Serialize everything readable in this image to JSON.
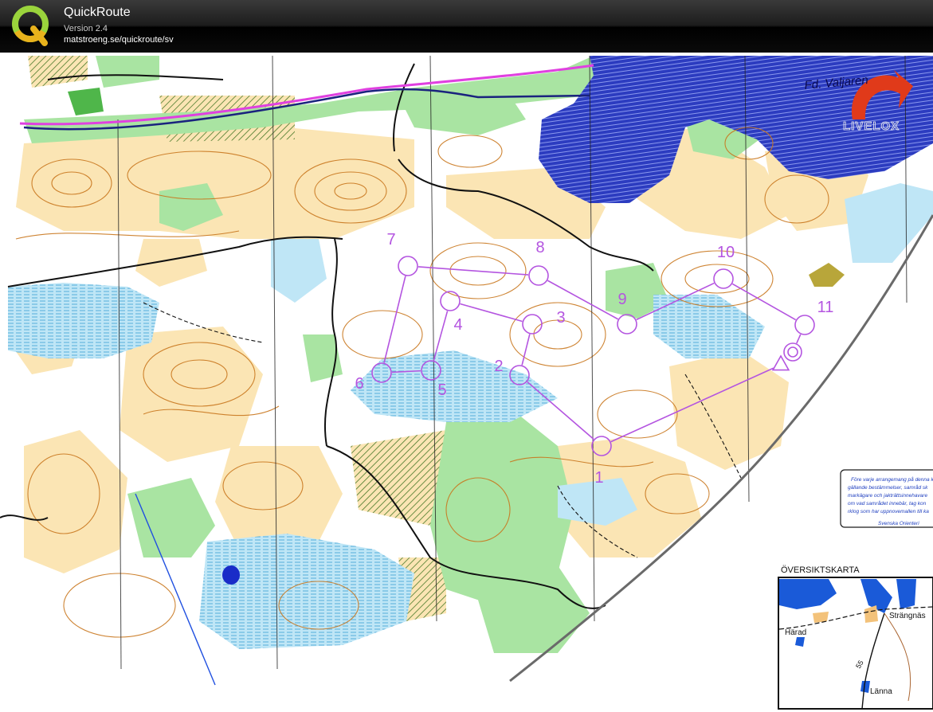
{
  "app": {
    "name": "QuickRoute",
    "version": "Version 2.4",
    "url": "matstroeng.se/quickroute/sv"
  },
  "map": {
    "lake_label": "Fd. Valjaren",
    "brand_logo": "LIVELOX",
    "overview_title": "ÖVERSIKTSKARTA",
    "overview_places": [
      "Strängnäs",
      "Härad",
      "Länna"
    ],
    "road_number": "55",
    "notice_lines": [
      "Före varje arrangemang på denna k",
      "gällande bestämmelser, samråd sk",
      "markägare och jakträttsinnehavare",
      "om vad samrådet innebär, tag kon",
      "rklog som har uppnovemallen till ka",
      "Svenska Orienteri"
    ]
  },
  "course": {
    "color": "#b455e0",
    "controls": [
      {
        "label": "1"
      },
      {
        "label": "2"
      },
      {
        "label": "3"
      },
      {
        "label": "4"
      },
      {
        "label": "5"
      },
      {
        "label": "6"
      },
      {
        "label": "7"
      },
      {
        "label": "8"
      },
      {
        "label": "9"
      },
      {
        "label": "10"
      },
      {
        "label": "11"
      }
    ]
  },
  "colors": {
    "forest": "#ffffff",
    "open_land": "#fbe5b4",
    "green": "#a9e4a2",
    "marsh_blue": "#bfe6f6",
    "water": "#2c3cc0",
    "contour": "#c9771e",
    "power_line": "#e040e0"
  }
}
